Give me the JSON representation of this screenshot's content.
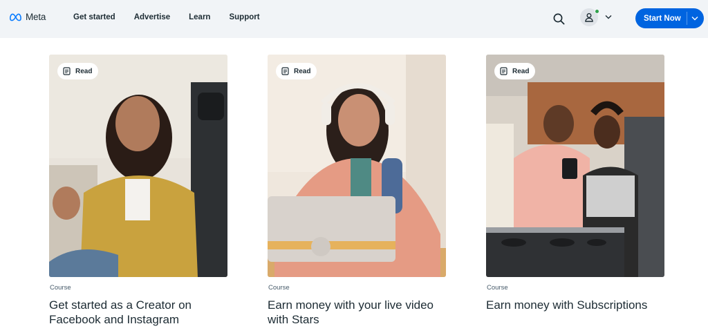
{
  "header": {
    "logo_text": "Meta",
    "nav": [
      {
        "label": "Get started"
      },
      {
        "label": "Advertise"
      },
      {
        "label": "Learn"
      },
      {
        "label": "Support"
      }
    ],
    "cta_label": "Start Now",
    "icons": {
      "search": "search-icon",
      "avatar": "user-icon",
      "chevron": "chevron-down-icon"
    }
  },
  "cards": [
    {
      "badge": "Read",
      "category": "Course",
      "title": "Get started as a Creator on Facebook and Instagram"
    },
    {
      "badge": "Read",
      "category": "Course",
      "title": "Earn money with your live video with Stars"
    },
    {
      "badge": "Read",
      "category": "Course",
      "title": "Earn money with Subscriptions"
    }
  ],
  "colors": {
    "topbar_bg": "#f1f4f7",
    "accent": "#0064e0",
    "status_online": "#31a24c",
    "text": "#1c2b33"
  }
}
